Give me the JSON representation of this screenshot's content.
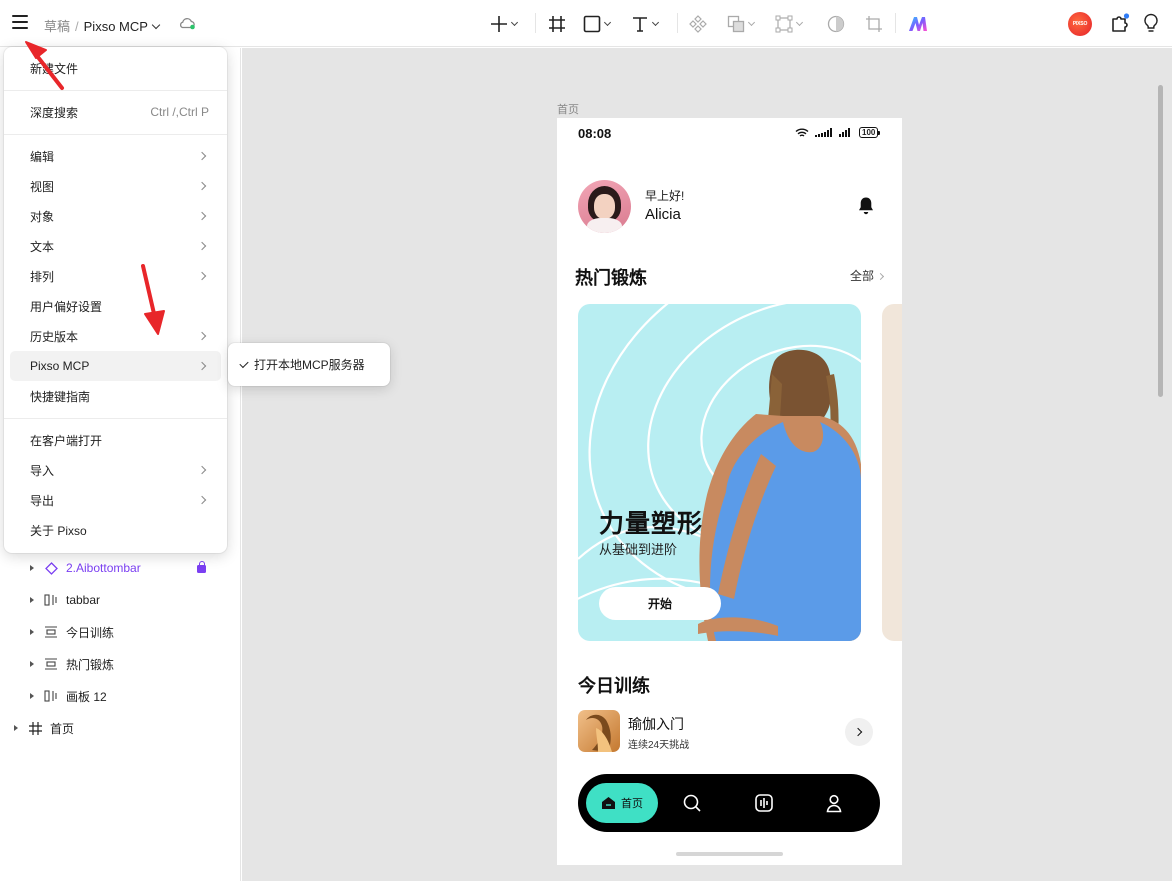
{
  "topbar": {
    "breadcrumb_folder": "草稿",
    "breadcrumb_sep": "/",
    "file_name": "Pixso MCP"
  },
  "main_menu": {
    "items": [
      {
        "label": "新建文件"
      },
      {
        "label": "深度搜索",
        "shortcut": "Ctrl /,Ctrl P"
      },
      {
        "label": "编辑"
      },
      {
        "label": "视图"
      },
      {
        "label": "对象"
      },
      {
        "label": "文本"
      },
      {
        "label": "排列"
      },
      {
        "label": "用户偏好设置"
      },
      {
        "label": "历史版本"
      },
      {
        "label": "Pixso MCP"
      },
      {
        "label": "快捷键指南"
      },
      {
        "label": "在客户端打开"
      },
      {
        "label": "导入"
      },
      {
        "label": "导出"
      },
      {
        "label": "关于 Pixso"
      }
    ]
  },
  "submenu": {
    "item_label": "打开本地MCP服务器"
  },
  "layers": [
    {
      "name": "2.Aibottombar"
    },
    {
      "name": "tabbar"
    },
    {
      "name": "今日训练"
    },
    {
      "name": "热门锻炼"
    },
    {
      "name": "画板 12"
    },
    {
      "name": "首页"
    }
  ],
  "canvas": {
    "frame_label": "首页"
  },
  "phone": {
    "time": "08:08",
    "battery": "100",
    "greeting": "早上好!",
    "user_name": "Alicia",
    "section_hot": "热门锻炼",
    "see_all": "全部",
    "card_title": "力量塑形",
    "card_subtitle": "从基础到进阶",
    "card_button": "开始",
    "section_today": "今日训练",
    "today_item_title": "瑜伽入门",
    "today_item_subtitle": "连续24天挑战",
    "tab_home": "首页"
  },
  "badge_text": "PIXSO",
  "colors": {
    "accent_purple": "#7b3ff2",
    "card_bg": "#b8eef2",
    "tab_active": "#3fe0c5",
    "annotation_red": "#e8262a"
  }
}
